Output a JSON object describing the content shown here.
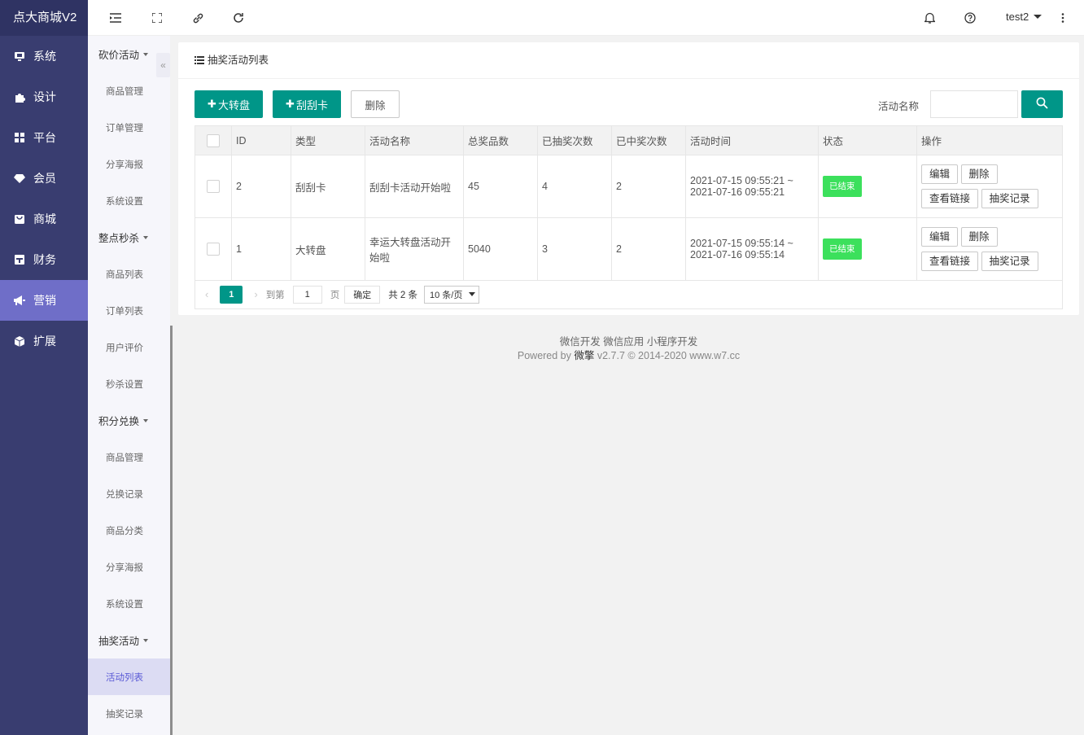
{
  "brand": "点大商城V2",
  "nav": [
    {
      "label": "系统",
      "icon": "monitor-icon"
    },
    {
      "label": "设计",
      "icon": "puzzle-icon"
    },
    {
      "label": "平台",
      "icon": "grid-icon"
    },
    {
      "label": "会员",
      "icon": "diamond-icon"
    },
    {
      "label": "商城",
      "icon": "bag-icon"
    },
    {
      "label": "财务",
      "icon": "wallet-icon"
    },
    {
      "label": "营销",
      "icon": "megaphone-icon"
    },
    {
      "label": "扩展",
      "icon": "cube-icon"
    }
  ],
  "subnav": {
    "groups": [
      {
        "title": "砍价活动",
        "items": [
          "商品管理",
          "订单管理",
          "分享海报",
          "系统设置"
        ]
      },
      {
        "title": "整点秒杀",
        "items": [
          "商品列表",
          "订单列表",
          "用户评价",
          "秒杀设置"
        ]
      },
      {
        "title": "积分兑换",
        "items": [
          "商品管理",
          "兑换记录",
          "商品分类",
          "分享海报",
          "系统设置"
        ]
      },
      {
        "title": "抽奖活动",
        "items": [
          "活动列表",
          "抽奖记录"
        ]
      }
    ]
  },
  "header": {
    "user": "test2"
  },
  "card": {
    "title": "抽奖活动列表",
    "btn_wheel": "大转盘",
    "btn_scratch": "刮刮卡",
    "btn_delete": "删除",
    "search_label": "活动名称",
    "search_value": ""
  },
  "table": {
    "columns": [
      "ID",
      "类型",
      "活动名称",
      "总奖品数",
      "已抽奖次数",
      "已中奖次数",
      "活动时间",
      "状态",
      "操作"
    ],
    "rows": [
      {
        "id": "2",
        "type": "刮刮卡",
        "name": "刮刮卡活动开始啦",
        "total": "45",
        "drawn": "4",
        "won": "2",
        "time_start": "2021-07-15 09:55:21 ~",
        "time_end": "2021-07-16 09:55:21",
        "status": "已结束",
        "ops": [
          "编辑",
          "删除",
          "查看链接",
          "抽奖记录"
        ]
      },
      {
        "id": "1",
        "type": "大转盘",
        "name": "幸运大转盘活动开始啦",
        "total": "5040",
        "drawn": "3",
        "won": "2",
        "time_start": "2021-07-15 09:55:14 ~",
        "time_end": "2021-07-16 09:55:14",
        "status": "已结束",
        "ops": [
          "编辑",
          "删除",
          "查看链接",
          "抽奖记录"
        ]
      }
    ]
  },
  "pager": {
    "current": "1",
    "goto_label": "到第",
    "goto_value": "1",
    "page_unit": "页",
    "confirm": "确定",
    "total": "共 2 条",
    "page_size": "10 条/页"
  },
  "footer": {
    "links": "微信开发 微信应用 小程序开发",
    "powered_prefix": "Powered by ",
    "powered_brand": "微擎",
    "powered_suffix": " v2.7.7 © 2014-2020 www.w7.cc"
  },
  "colors": {
    "sidebar": "#393d70",
    "accent": "#009688",
    "active_nav": "#6f6ec8",
    "status_green": "#3ce05c"
  }
}
